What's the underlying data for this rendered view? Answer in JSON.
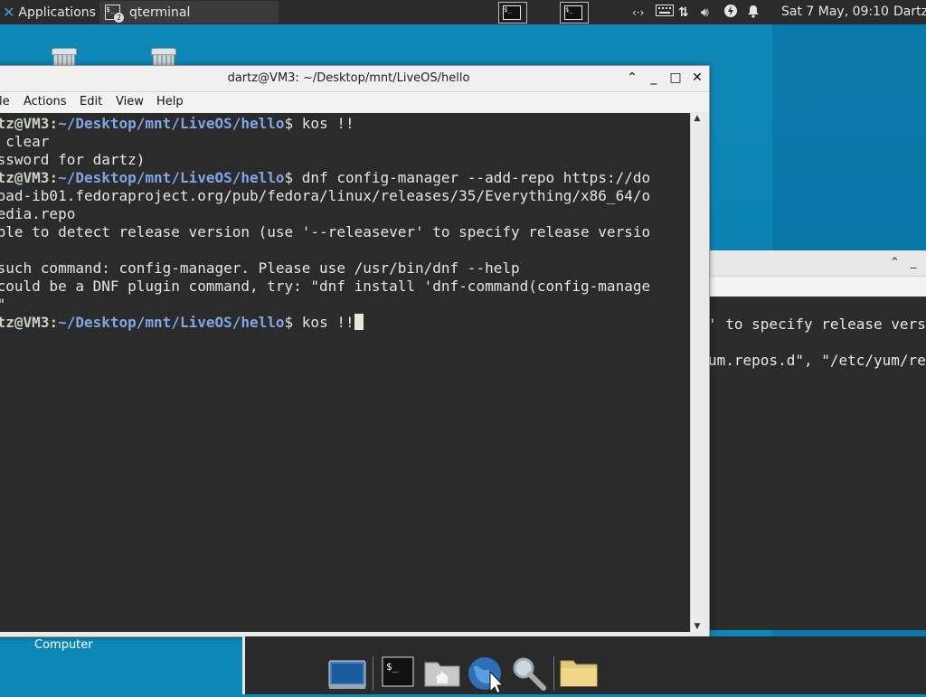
{
  "top_panel": {
    "applications_label": "Applications",
    "applications_sep": "≡",
    "task_label": "qterminal",
    "task_badge": "2",
    "tray_icons": [
      "network-icon",
      "keyboard-icon",
      "transfer-icon",
      "volume-icon",
      "power-icon",
      "notification-icon"
    ],
    "clock": "Sat  7 May, 09:10",
    "user": "Dartz"
  },
  "desktop": {
    "computer_label": "Computer"
  },
  "terminal_window": {
    "title": "dartz@VM3: ~/Desktop/mnt/LiveOS/hello",
    "menu": [
      "le",
      "Actions",
      "Edit",
      "View",
      "Help"
    ],
    "lines": [
      {
        "user": "rtz@VM3",
        "sep": ":",
        "path": "~/Desktop/mnt/LiveOS/hello",
        "text": "$ kos !!"
      },
      {
        "text": "s clear"
      },
      {
        "text": "assword for dartz)"
      },
      {
        "user": "rtz@VM3",
        "sep": ":",
        "path": "~/Desktop/mnt/LiveOS/hello",
        "text": "$ dnf config-manager --add-repo https://do"
      },
      {
        "text": "load-ib01.fedoraproject.org/pub/fedora/linux/releases/35/Everything/x86_64/o"
      },
      {
        "text": "media.repo"
      },
      {
        "text": "able to detect release version (use '--releasever' to specify release versio"
      },
      {
        "text": ""
      },
      {
        "text": " such command: config-manager. Please use /usr/bin/dnf --help"
      },
      {
        "text": " could be a DNF plugin command, try: \"dnf install 'dnf-command(config-manage"
      },
      {
        "text": "'\""
      },
      {
        "user": "rtz@VM3",
        "sep": ":",
        "path": "~/Desktop/mnt/LiveOS/hello",
        "text": "$ kos !!"
      }
    ]
  },
  "background_window": {
    "lines": [
      "' to specify release vers",
      "",
      "um.repos.d\", \"/etc/yum/re"
    ]
  },
  "colors": {
    "desktop": "#0e86b3",
    "panel": "#2b2b2b",
    "terminal_bg": "#2b2b2b",
    "prompt_path": "#7fa6e6"
  }
}
